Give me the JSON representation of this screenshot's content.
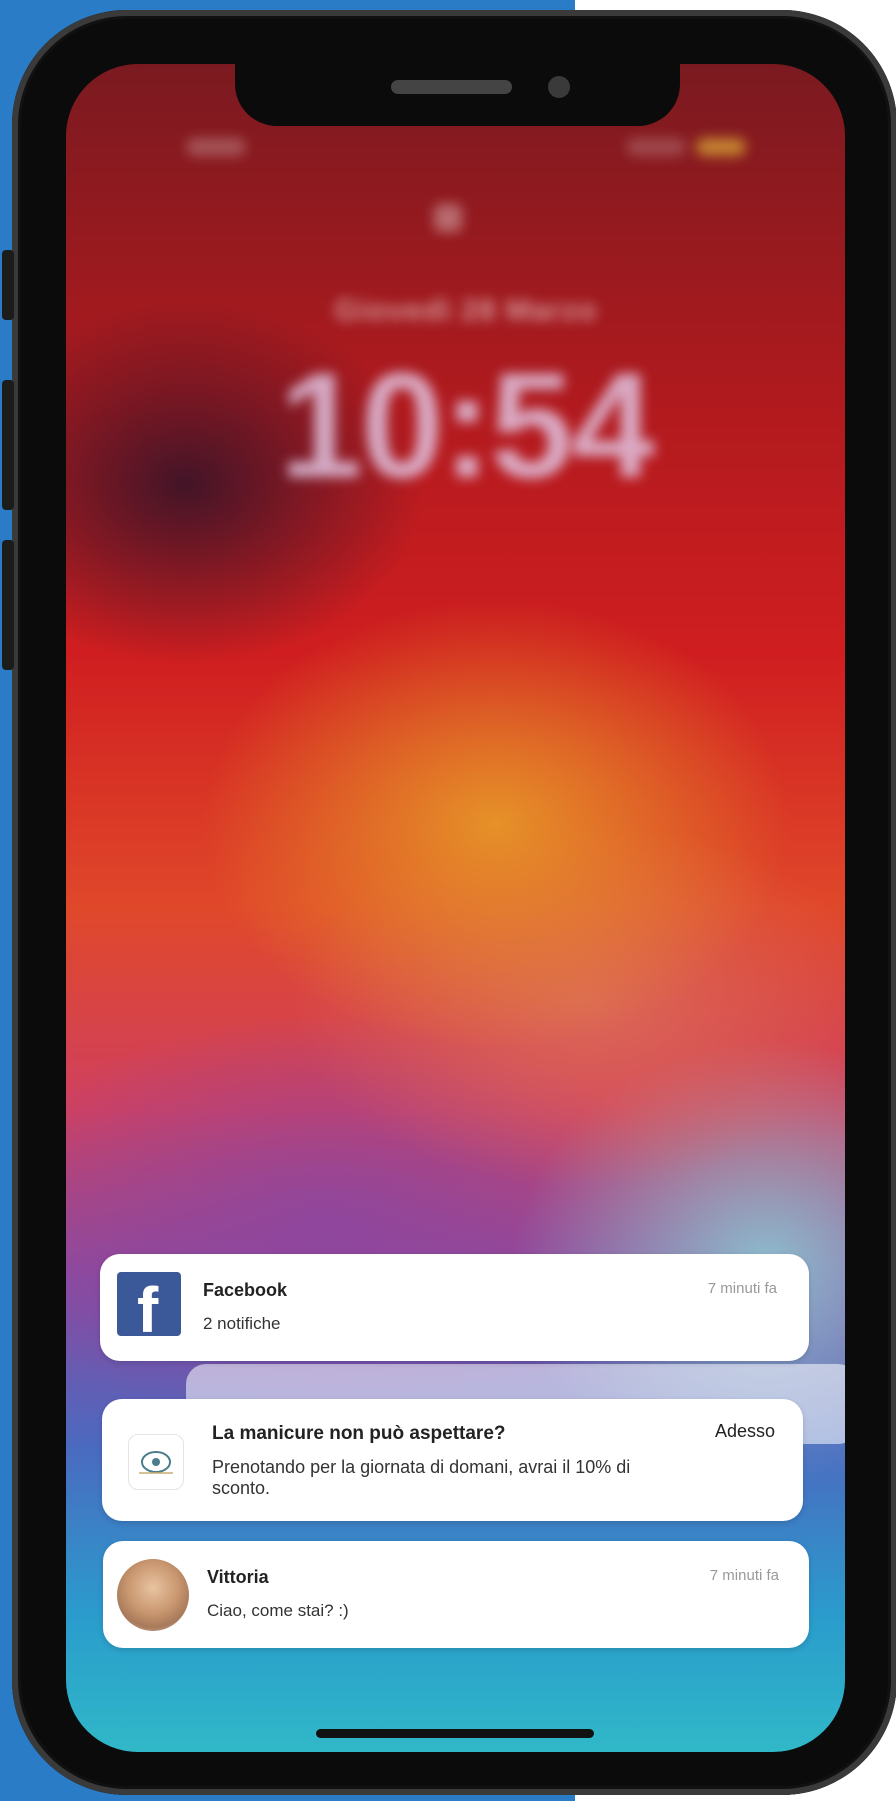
{
  "lockscreen": {
    "date": "Giovedì 28 Marzo",
    "time": "10:54"
  },
  "notifications": [
    {
      "app": "Facebook",
      "title": "Facebook",
      "body": "2 notifiche",
      "time": "7 minuti fa",
      "icon": "facebook-icon"
    },
    {
      "app": "salon",
      "title": "La manicure non può aspettare?",
      "body": "Prenotando per la giornata di domani, avrai il 10% di sconto.",
      "time": "Adesso",
      "icon": "salon-logo-icon"
    },
    {
      "app": "messages",
      "title": "Vittoria",
      "body": "Ciao, come stai? :)",
      "time": "7 minuti fa",
      "icon": "avatar"
    }
  ],
  "colors": {
    "background_accent": "#2a7cc7",
    "facebook_brand": "#3b5998",
    "phone_frame": "#0b0b0b"
  }
}
